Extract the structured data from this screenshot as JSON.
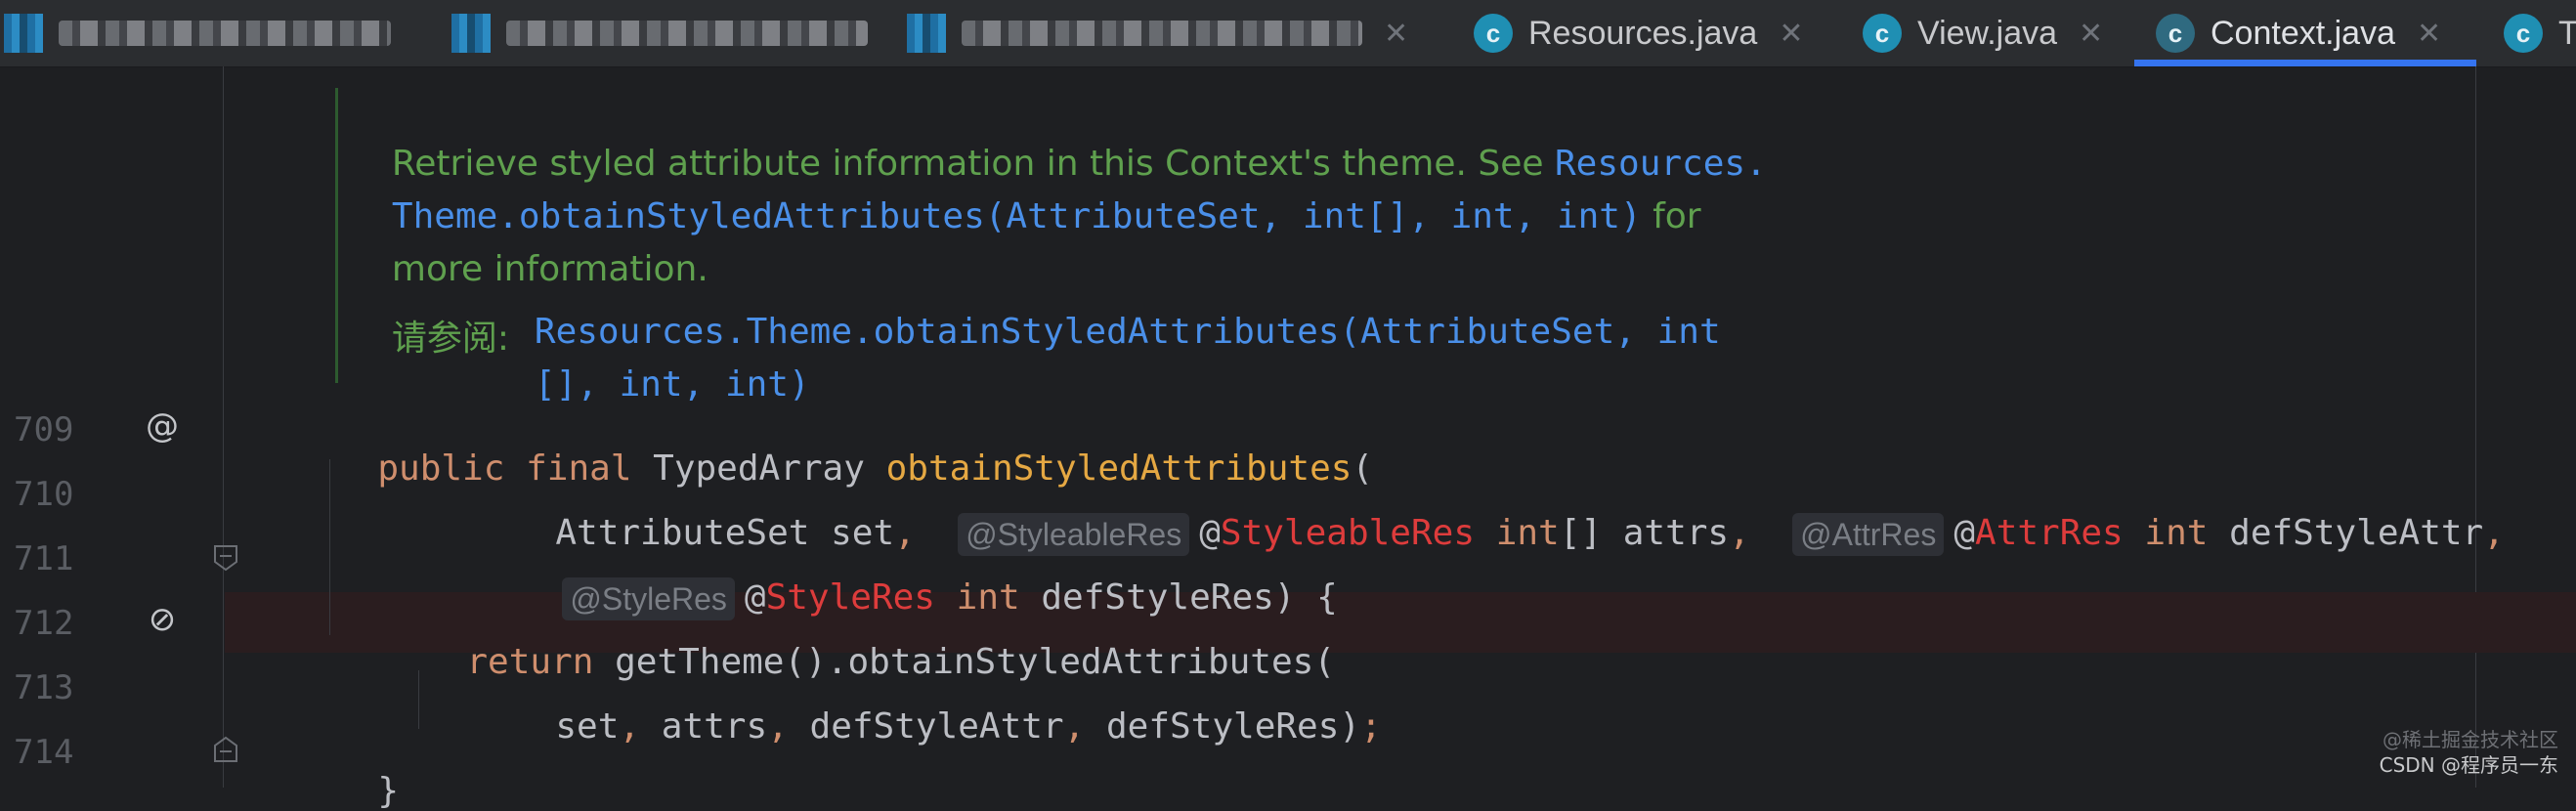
{
  "tabs": [
    {
      "label": "",
      "blurred": true
    },
    {
      "label": "",
      "blurred": true
    },
    {
      "label": "",
      "blurred": true
    },
    {
      "label": "Resources.java",
      "icon": "class-icon"
    },
    {
      "label": "View.java",
      "icon": "class-icon"
    },
    {
      "label": "Context.java",
      "icon": "class-icon",
      "active": true
    },
    {
      "label": "T",
      "icon": "class-icon"
    }
  ],
  "icon_letter": "c",
  "doc": {
    "line1_text": "Retrieve styled attribute information in this Context's theme. See ",
    "line1_link": "Resources.",
    "line2_link": "Theme.obtainStyledAttributes(AttributeSet, int[], int, int)",
    "line2_text": " for",
    "line3_text": "more information.",
    "see_label": "请参阅:",
    "see_link_1": "Resources.Theme.obtainStyledAttributes(AttributeSet, int",
    "see_link_2": "[], int, int)"
  },
  "lines": {
    "l709": "709",
    "l710": "710",
    "l711": "711",
    "l712": "712",
    "l713": "713",
    "l714": "714"
  },
  "code": {
    "public": "public",
    "final": "final",
    "typed_array": "TypedArray",
    "method": "obtainStyledAttributes",
    "open_paren": "(",
    "attr_set": "AttributeSet set",
    "comma": ",",
    "hint_styleable": "@StyleableRes",
    "at": "@",
    "styleable_res": "StyleableRes",
    "int": "int",
    "int_array_attrs": "[] attrs",
    "hint_attr": "@AttrRes",
    "attr_res": "AttrRes",
    "def_style_attr": "defStyleAttr",
    "hint_style": "@StyleRes",
    "style_res": "StyleRes",
    "def_style_res_close": "defStyleRes) {",
    "return": "return",
    "return_call": "getTheme().obtainStyledAttributes(",
    "set": "set",
    "attrs": "attrs",
    "def_style_res": "defStyleRes",
    "close_semi_paren": ")",
    "semi": ";",
    "close_brace": "}"
  },
  "gutter": {
    "override_symbol": "@",
    "breakpoint_symbol": "⊘"
  },
  "watermark": {
    "line1": "@稀土掘金技术社区",
    "line2": "CSDN @程序员一东"
  },
  "colors": {
    "background": "#1e1f22",
    "keyword": "#cf8e6d",
    "method": "#e5a843",
    "annotation": "#dd3c3c",
    "doc_text": "#5fa04e",
    "doc_link": "#4a8fe8",
    "active_tab_underline": "#3574f0"
  }
}
